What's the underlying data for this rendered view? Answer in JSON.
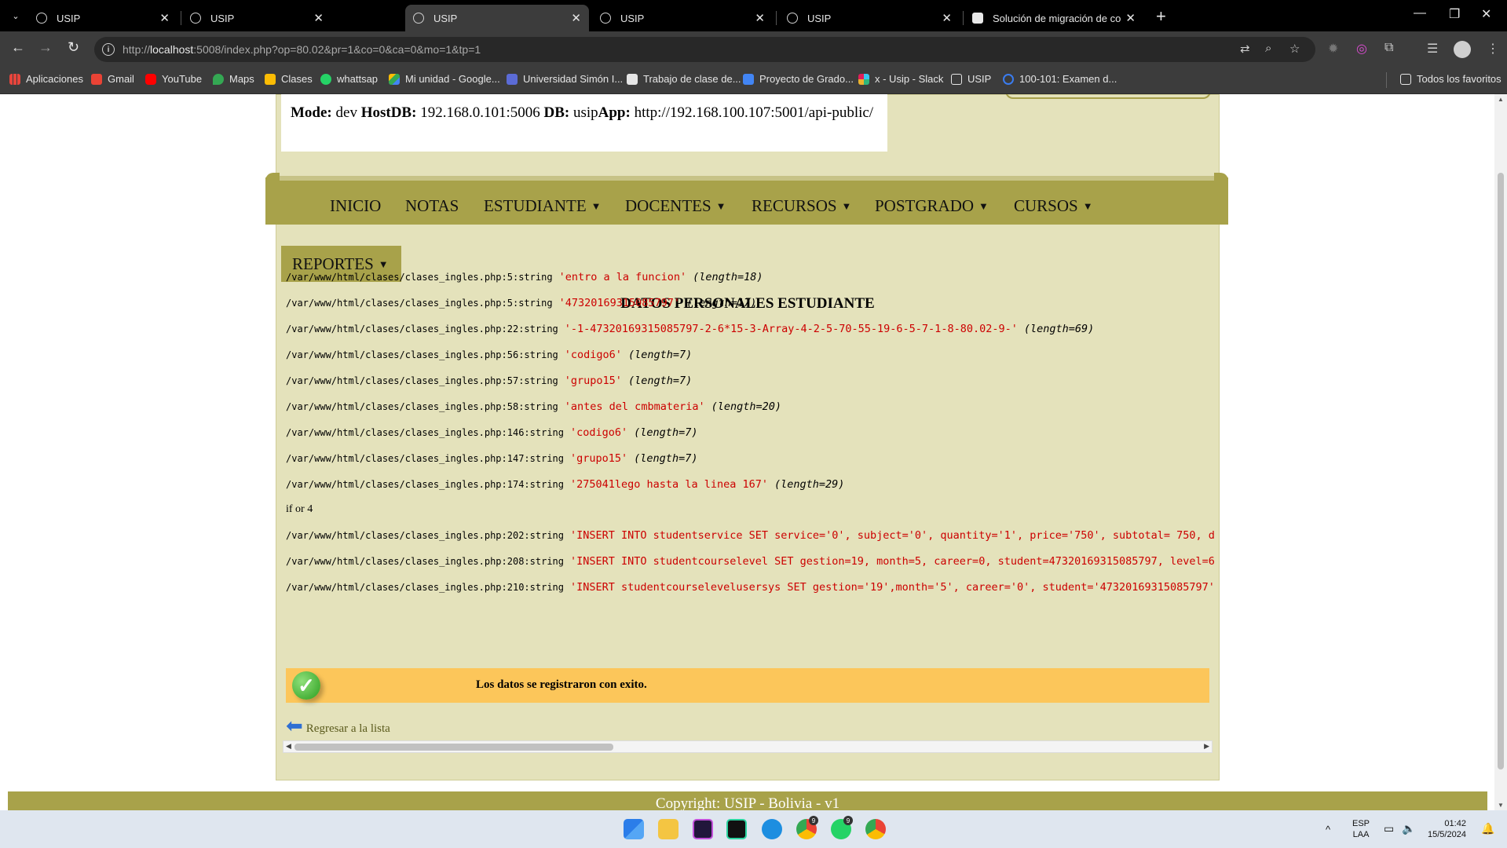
{
  "browser": {
    "tabs": [
      {
        "title": "USIP",
        "active": false
      },
      {
        "title": "USIP",
        "active": false
      },
      {
        "title": "USIP",
        "active": true
      },
      {
        "title": "USIP",
        "active": false
      },
      {
        "title": "USIP",
        "active": false
      },
      {
        "title": "Solución de migración de conte",
        "active": false
      }
    ],
    "url_prefix": "http://",
    "url_host": "localhost",
    "url_rest": ":5008/index.php?op=80.02&pr=1&co=0&ca=0&mo=1&tp=1",
    "bookmarks": [
      "Aplicaciones",
      "Gmail",
      "YouTube",
      "Maps",
      "Clases",
      "whattsap",
      "Mi unidad - Google...",
      "Universidad Simón I...",
      "Trabajo de clase de...",
      "Proyecto de Grado...",
      "x - Usip - Slack",
      "USIP",
      "100-101: Examen d..."
    ],
    "all_bookmarks": "Todos los favoritos"
  },
  "page": {
    "info": {
      "mode_label": "Mode:",
      "mode_value": "dev",
      "hostdb_label": "HostDB:",
      "hostdb_value": "192.168.0.101:5006",
      "db_label": "DB:",
      "db_value": "usip",
      "app_label": "App:",
      "app_value": "http://192.168.100.107:5001/api-public/"
    },
    "menu": [
      "INICIO",
      "NOTAS",
      "ESTUDIANTE",
      "DOCENTES",
      "RECURSOS",
      "POSTGRADO",
      "CURSOS"
    ],
    "menu_caret": "▼",
    "reportes_label": "REPORTES",
    "heading": "DATOS PERSONALES ESTUDIANTE",
    "dump": [
      {
        "path": "/var/www/html/clases/clases_ingles.php:5:string",
        "value": "'entro a la funcion'",
        "length": "(length=18)"
      },
      {
        "path": "/var/www/html/clases/clases_ingles.php:5:string",
        "value": "'47320169315085797'",
        "length": "(length=17)"
      },
      {
        "path": "/var/www/html/clases/clases_ingles.php:22:string",
        "value": "'-1-47320169315085797-2-6*15-3-Array-4-2-5-70-55-19-6-5-7-1-8-80.02-9-'",
        "length": "(length=69)"
      },
      {
        "path": "/var/www/html/clases/clases_ingles.php:56:string",
        "value": "'codigo6'",
        "length": "(length=7)"
      },
      {
        "path": "/var/www/html/clases/clases_ingles.php:57:string",
        "value": "'grupo15'",
        "length": "(length=7)"
      },
      {
        "path": "/var/www/html/clases/clases_ingles.php:58:string",
        "value": "'antes del cmbmateria'",
        "length": "(length=20)"
      },
      {
        "path": "/var/www/html/clases/clases_ingles.php:146:string",
        "value": "'codigo6'",
        "length": "(length=7)"
      },
      {
        "path": "/var/www/html/clases/clases_ingles.php:147:string",
        "value": "'grupo15'",
        "length": "(length=7)"
      },
      {
        "path": "/var/www/html/clases/clases_ingles.php:174:string",
        "value": "'275041lego hasta la linea 167'",
        "length": "(length=29)"
      }
    ],
    "plain_line": "if or 4",
    "sql_dump": [
      {
        "path": "/var/www/html/clases/clases_ingles.php:202:string",
        "value": "'INSERT INTO studentservice SET service='0', subject='0', quantity='1', price='750', subtotal= 750, d"
      },
      {
        "path": "/var/www/html/clases/clases_ingles.php:208:string",
        "value": "'INSERT INTO studentcourselevel SET gestion=19, month=5, career=0, student=47320169315085797, level=6"
      },
      {
        "path": "/var/www/html/clases/clases_ingles.php:210:string",
        "value": "'INSERT studentcourselevelusersys SET gestion='19',month='5', career='0', student='47320169315085797'"
      }
    ],
    "success_message": "Los datos se registraron con exito.",
    "back_link": "Regresar a la lista",
    "footer": "Copyright: USIP - Bolivia - v1"
  },
  "taskbar": {
    "lang_top": "ESP",
    "lang_bottom": "LAA",
    "time": "01:42",
    "date": "15/5/2024",
    "badges": [
      "9",
      "9"
    ]
  }
}
